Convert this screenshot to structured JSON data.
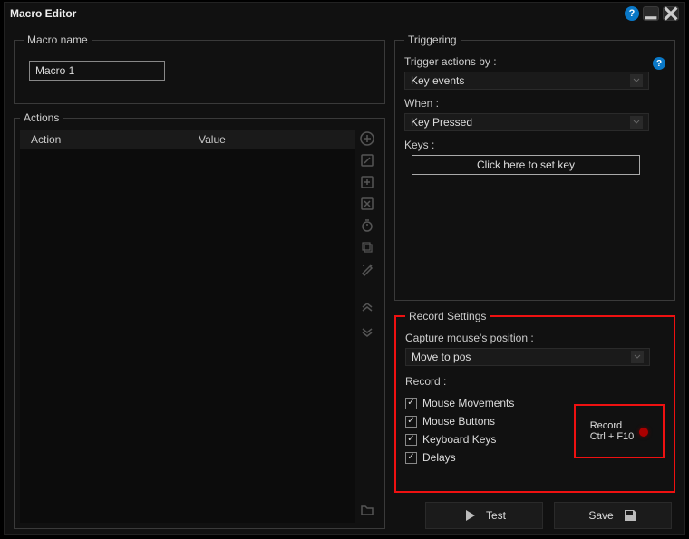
{
  "window": {
    "title": "Macro Editor"
  },
  "macro_name": {
    "legend": "Macro name",
    "value": "Macro 1"
  },
  "actions": {
    "legend": "Actions",
    "columns": {
      "action": "Action",
      "value": "Value"
    },
    "rows": []
  },
  "triggering": {
    "legend": "Triggering",
    "trigger_actions_by_label": "Trigger actions by :",
    "trigger_actions_by_value": "Key events",
    "when_label": "When :",
    "when_value": "Key Pressed",
    "keys_label": "Keys :",
    "set_key_button": "Click here to set key"
  },
  "record_settings": {
    "legend": "Record Settings",
    "capture_label": "Capture mouse's position :",
    "capture_value": "Move to pos",
    "record_label": "Record :",
    "checks": {
      "mouse_movements": {
        "label": "Mouse Movements",
        "checked": true
      },
      "mouse_buttons": {
        "label": "Mouse Buttons",
        "checked": true
      },
      "keyboard_keys": {
        "label": "Keyboard Keys",
        "checked": true
      },
      "delays": {
        "label": "Delays",
        "checked": true
      }
    },
    "record_button": {
      "label": "Record",
      "shortcut": "Ctrl + F10"
    }
  },
  "buttons": {
    "test": "Test",
    "save": "Save"
  },
  "colors": {
    "accent_red": "#e11",
    "help_blue": "#0a78c7"
  }
}
